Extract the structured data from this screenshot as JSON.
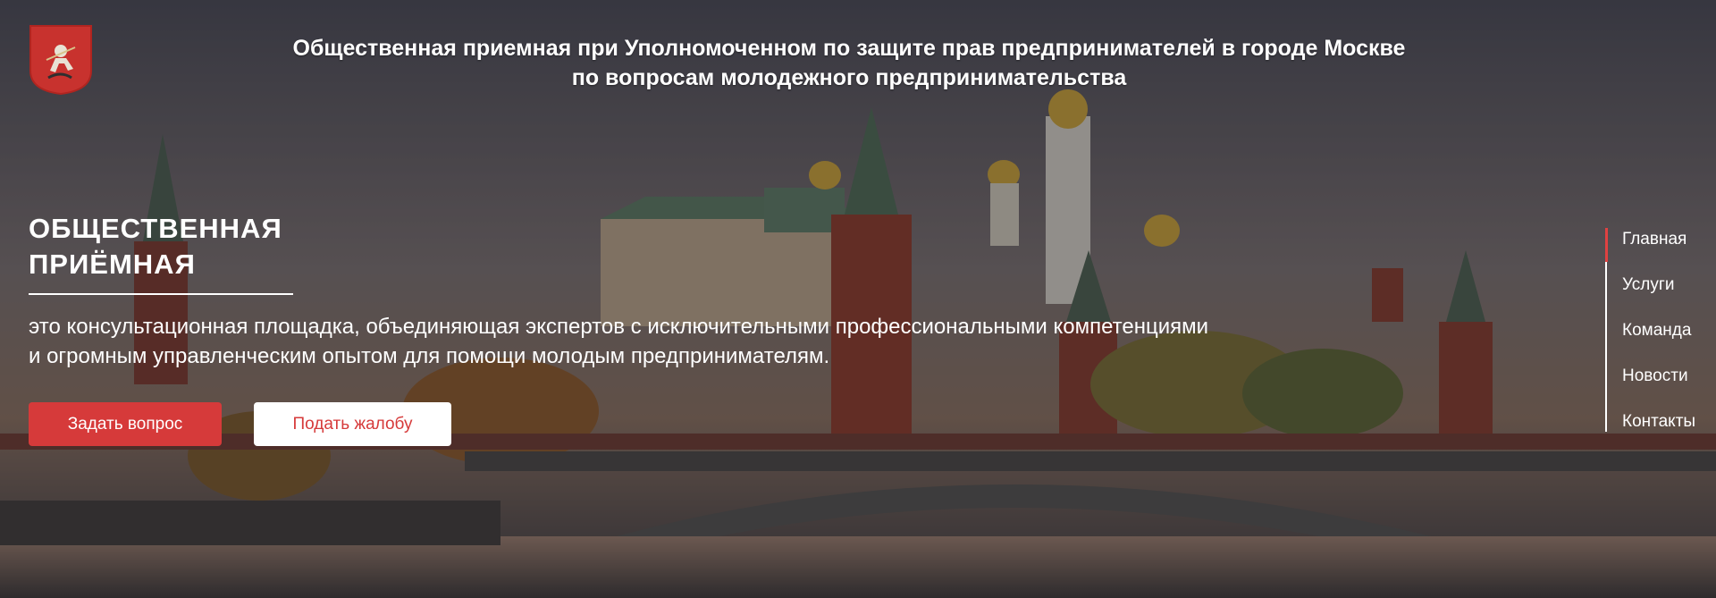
{
  "header": {
    "title_line1": "Общественная приемная при Уполномоченном по защите прав предпринимателей в городе Москве",
    "title_line2": "по вопросам молодежного предпринимательства"
  },
  "hero": {
    "heading_line1": "ОБЩЕСТВЕННАЯ",
    "heading_line2": "ПРИЁМНАЯ",
    "description_line1": "это консультационная площадка, объединяющая экспертов с исключительными профессиональными компетенциями",
    "description_line2": "и огромным управленческим опытом для помощи молодым предпринимателям.",
    "ask_button": "Задать вопрос",
    "complaint_button": "Подать жалобу"
  },
  "nav": {
    "items": [
      {
        "label": "Главная",
        "active": true
      },
      {
        "label": "Услуги"
      },
      {
        "label": "Команда"
      },
      {
        "label": "Новости"
      },
      {
        "label": "Контакты"
      }
    ]
  },
  "icons": {
    "emblem": "moscow-coat-of-arms-icon"
  },
  "colors": {
    "accent": "#d63a3a",
    "overlay": "#141419"
  }
}
